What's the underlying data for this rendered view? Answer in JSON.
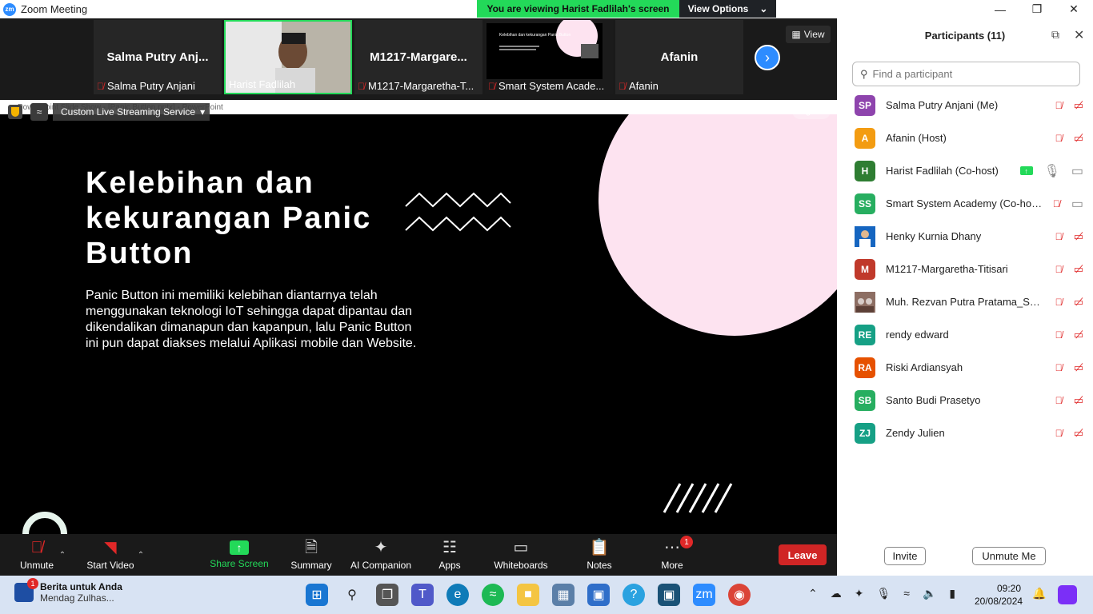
{
  "window": {
    "title": "Zoom Meeting",
    "logo": "zm"
  },
  "banner": {
    "message": "You are viewing Harist Fadlilah's screen",
    "options_label": "View Options"
  },
  "strip": {
    "tiles": [
      {
        "big_name": "Salma Putry Anj...",
        "label": "Salma Putry Anjani",
        "muted": true
      },
      {
        "big_name": "",
        "label": "Harist Fadlilah",
        "muted": false
      },
      {
        "big_name": "M1217-Margare...",
        "label": "M1217-Margaretha-T...",
        "muted": true
      },
      {
        "big_name": "",
        "label": "Smart System Acade...",
        "muted": true
      },
      {
        "big_name": "Afanin",
        "label": "Afanin",
        "muted": true
      }
    ],
    "view_label": "View"
  },
  "share": {
    "ppt_title": "PowerPoint Slide Show - [Panic Button.pptx] - PowerPoint",
    "stream_label": "Custom Live Streaming Service",
    "sign_in": "Sign in",
    "slide_title": "Kelebihan dan kekurangan Panic Button",
    "slide_body": "Panic Button ini memiliki kelebihan diantarnya telah menggunakan teknologi IoT sehingga dapat dipantau dan dikendalikan dimanapun dan kapanpun, lalu Panic Button ini pun dapat diakses melalui Aplikasi mobile dan Website.",
    "thumb_text": "Kelebihan dan kekurangan Panic Button"
  },
  "toolbar": {
    "unmute": "Unmute",
    "start_video": "Start Video",
    "share_screen": "Share Screen",
    "summary": "Summary",
    "ai_companion": "AI Companion",
    "apps": "Apps",
    "whiteboards": "Whiteboards",
    "notes": "Notes",
    "more": "More",
    "more_badge": "1",
    "leave": "Leave"
  },
  "panel": {
    "title": "Participants (11)",
    "search_placeholder": "Find a participant",
    "participants": [
      {
        "initials": "SP",
        "name": "Salma Putry Anjani (Me)",
        "color": "#8e44ad"
      },
      {
        "initials": "A",
        "name": "Afanin (Host)",
        "color": "#f39c12"
      },
      {
        "initials": "H",
        "name": "Harist Fadlilah (Co-host)",
        "color": "#2e7d32"
      },
      {
        "initials": "SS",
        "name": "Smart System Academy (Co-host)",
        "color": "#27ae60"
      },
      {
        "initials": "",
        "name": "Henky Kurnia Dhany",
        "color": "#1565c0"
      },
      {
        "initials": "M",
        "name": "M1217-Margaretha-Titisari",
        "color": "#c0392b"
      },
      {
        "initials": "",
        "name": "Muh. Rezvan Putra Pratama_SM...",
        "color": "#8d6e63"
      },
      {
        "initials": "RE",
        "name": "rendy edward",
        "color": "#16a085"
      },
      {
        "initials": "RA",
        "name": "Riski Ardiansyah",
        "color": "#e65100"
      },
      {
        "initials": "SB",
        "name": "Santo Budi Prasetyo",
        "color": "#27ae60"
      },
      {
        "initials": "ZJ",
        "name": "Zendy Julien",
        "color": "#16a085"
      }
    ],
    "invite": "Invite",
    "unmute_me": "Unmute Me"
  },
  "taskbar": {
    "news_title": "Berita untuk Anda",
    "news_sub": "Mendag Zulhas...",
    "news_badge": "1",
    "time": "09:20",
    "date": "20/08/2024"
  }
}
